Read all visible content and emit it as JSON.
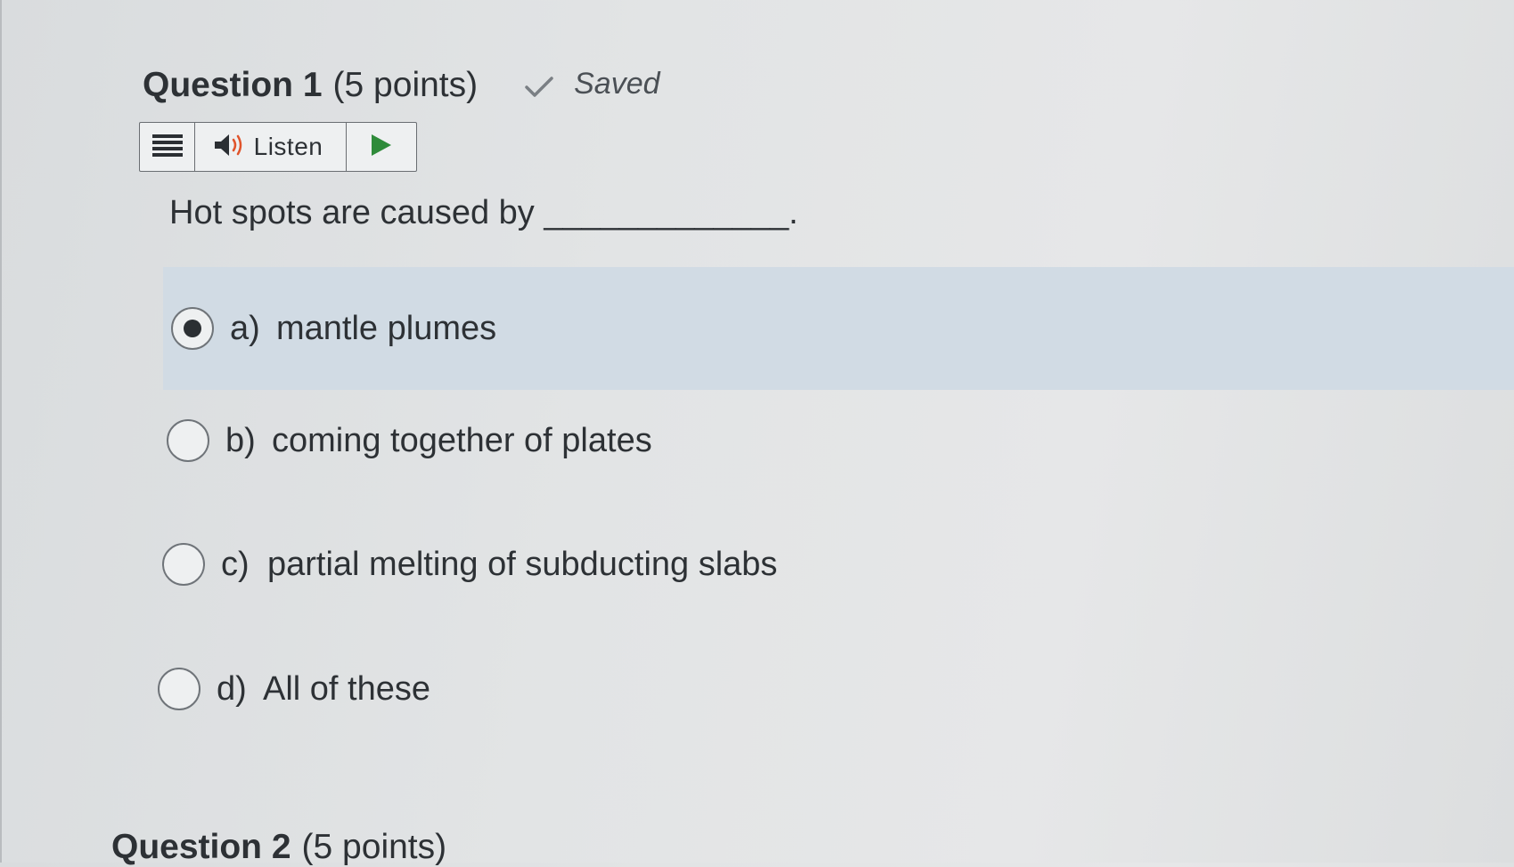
{
  "question1": {
    "title": "Question 1",
    "points": "(5 points)",
    "status": "Saved",
    "prompt": "Hot spots are caused by _____________.",
    "options": [
      {
        "letter": "a)",
        "text": "mantle plumes",
        "selected": true
      },
      {
        "letter": "b)",
        "text": "coming together of plates",
        "selected": false
      },
      {
        "letter": "c)",
        "text": "partial melting of subducting slabs",
        "selected": false
      },
      {
        "letter": "d)",
        "text": "All of these",
        "selected": false
      }
    ]
  },
  "toolbar": {
    "listen_label": "Listen",
    "icons": [
      "menu-icon",
      "speaker-icon",
      "play-icon"
    ]
  },
  "question2": {
    "title": "Question 2",
    "points": "(5 points)"
  },
  "colors": {
    "selected_row": "#d1dbe4",
    "play_green": "#2e8b3a",
    "text": "#2d3135"
  }
}
